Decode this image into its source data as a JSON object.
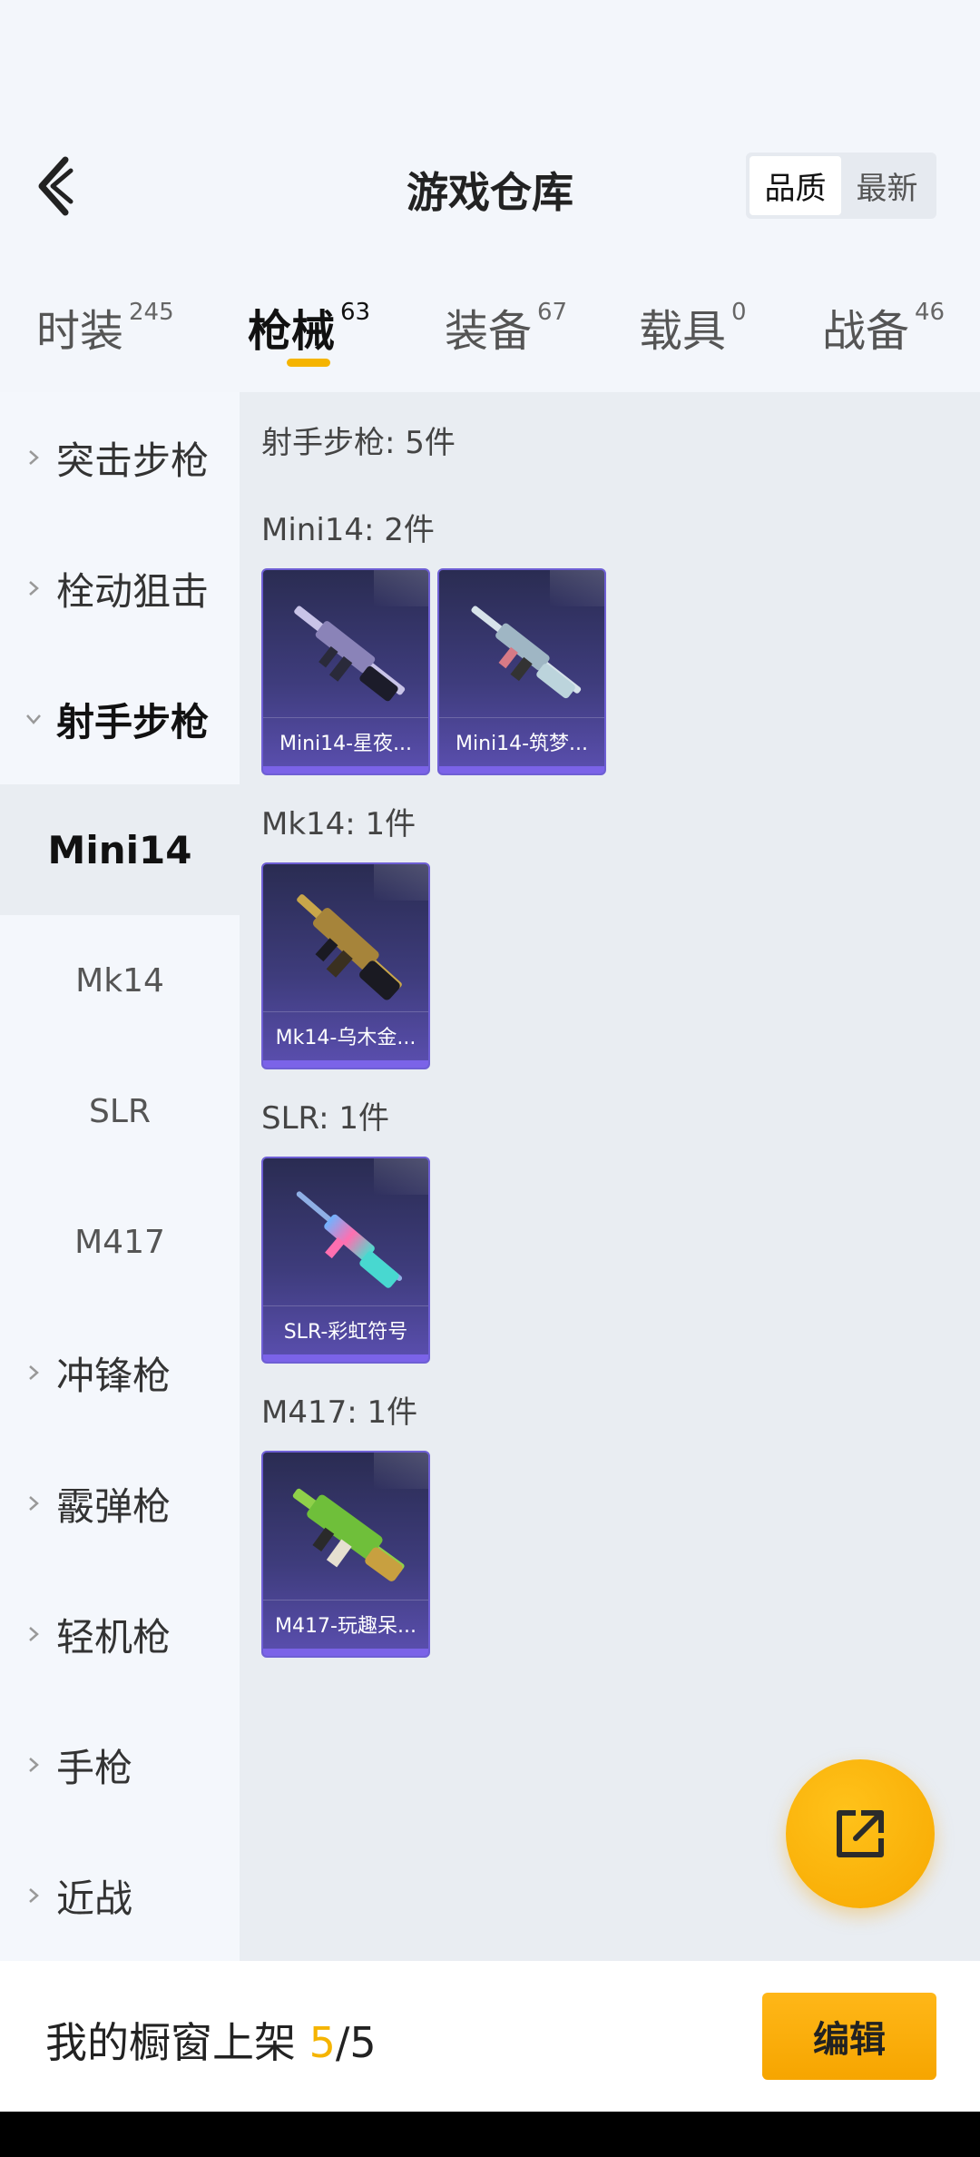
{
  "header": {
    "title": "游戏仓库",
    "sort_options": [
      {
        "label": "品质",
        "active": true
      },
      {
        "label": "最新",
        "active": false
      }
    ]
  },
  "tabs": [
    {
      "label": "时装",
      "count": "245",
      "active": false
    },
    {
      "label": "枪械",
      "count": "63",
      "active": true
    },
    {
      "label": "装备",
      "count": "67",
      "active": false
    },
    {
      "label": "载具",
      "count": "0",
      "active": false
    },
    {
      "label": "战备",
      "count": "46",
      "active": false
    }
  ],
  "sidebar": {
    "categories": [
      {
        "label": "突击步枪",
        "expanded": false
      },
      {
        "label": "栓动狙击",
        "expanded": false
      },
      {
        "label": "射手步枪",
        "expanded": true
      },
      {
        "label": "冲锋枪",
        "expanded": false
      },
      {
        "label": "霰弹枪",
        "expanded": false
      },
      {
        "label": "轻机枪",
        "expanded": false
      },
      {
        "label": "手枪",
        "expanded": false
      },
      {
        "label": "近战",
        "expanded": false
      }
    ],
    "subcategories": [
      {
        "label": "Mini14",
        "selected": true
      },
      {
        "label": "Mk14",
        "selected": false
      },
      {
        "label": "SLR",
        "selected": false
      },
      {
        "label": "M417",
        "selected": false
      }
    ]
  },
  "content": {
    "section_title": "射手步枪: 5件",
    "groups": [
      {
        "title": "Mini14: 2件",
        "items": [
          {
            "label": "Mini14-星夜...",
            "icon": "rifle-icon"
          },
          {
            "label": "Mini14-筑梦...",
            "icon": "rifle-icon"
          }
        ]
      },
      {
        "title": "Mk14: 1件",
        "items": [
          {
            "label": "Mk14-乌木金...",
            "icon": "rifle-icon"
          }
        ]
      },
      {
        "title": "SLR: 1件",
        "items": [
          {
            "label": "SLR-彩虹符号",
            "icon": "rifle-icon"
          }
        ]
      },
      {
        "title": "M417: 1件",
        "items": [
          {
            "label": "M417-玩趣呆...",
            "icon": "rifle-icon"
          }
        ]
      }
    ]
  },
  "bottom_bar": {
    "shelf_label": "我的橱窗上架",
    "shelf_current": "5",
    "shelf_total": "/5",
    "edit_label": "编辑"
  },
  "colors": {
    "accent": "#f5b400",
    "card_bg": "#3e3c7c",
    "card_border": "#6e5fd4"
  },
  "icons": {
    "back": "chevron-left-icon",
    "fab": "share-icon"
  }
}
